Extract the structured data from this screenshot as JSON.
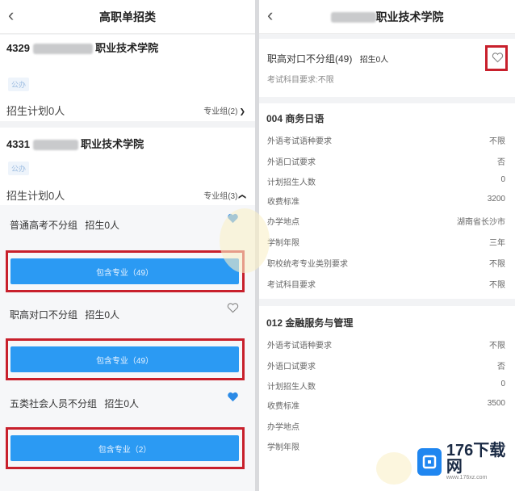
{
  "left": {
    "nav_title": "高职单招类",
    "school1": {
      "code": "4329",
      "name": "职业技术学院",
      "tag": "公办",
      "plan": "招生计划0人",
      "major_group": "专业组(2)"
    },
    "school2": {
      "code": "4331",
      "name": "职业技术学院",
      "tag": "公办",
      "plan": "招生计划0人",
      "major_group": "专业组(3)"
    },
    "groups": [
      {
        "label": "普通高考不分组",
        "enroll": "招生0人",
        "button": "包含专业（49）",
        "favorited": true
      },
      {
        "label": "职高对口不分组",
        "enroll": "招生0人",
        "button": "包含专业（49）",
        "favorited": false
      },
      {
        "label": "五类社会人员不分组",
        "enroll": "招生0人",
        "button": "包含专业（2）",
        "favorited": true
      }
    ]
  },
  "right": {
    "nav_title": "职业技术学院",
    "group_title": "职高对口不分组(49)",
    "group_enroll": "招生0人",
    "subject_req": "考试科目要求:不限",
    "majors": [
      {
        "title": "004 商务日语",
        "rows": [
          {
            "k": "外语考试语种要求",
            "v": "不限"
          },
          {
            "k": "外语口试要求",
            "v": "否"
          },
          {
            "k": "计划招生人数",
            "v": "0"
          },
          {
            "k": "收费标准",
            "v": "3200"
          },
          {
            "k": "办学地点",
            "v": "湖南省长沙市"
          },
          {
            "k": "学制年限",
            "v": "三年"
          },
          {
            "k": "职校统考专业类别要求",
            "v": "不限"
          },
          {
            "k": "考试科目要求",
            "v": "不限"
          }
        ]
      },
      {
        "title": "012 金融服务与管理",
        "rows": [
          {
            "k": "外语考试语种要求",
            "v": "不限"
          },
          {
            "k": "外语口试要求",
            "v": "否"
          },
          {
            "k": "计划招生人数",
            "v": "0"
          },
          {
            "k": "收费标准",
            "v": "3500"
          },
          {
            "k": "办学地点",
            "v": ""
          },
          {
            "k": "学制年限",
            "v": ""
          }
        ]
      }
    ]
  },
  "watermark": {
    "brand": "176下载网",
    "domain": "www.176xz.com"
  },
  "colors": {
    "accent": "#2b9af3",
    "highlight": "#c8202c"
  }
}
